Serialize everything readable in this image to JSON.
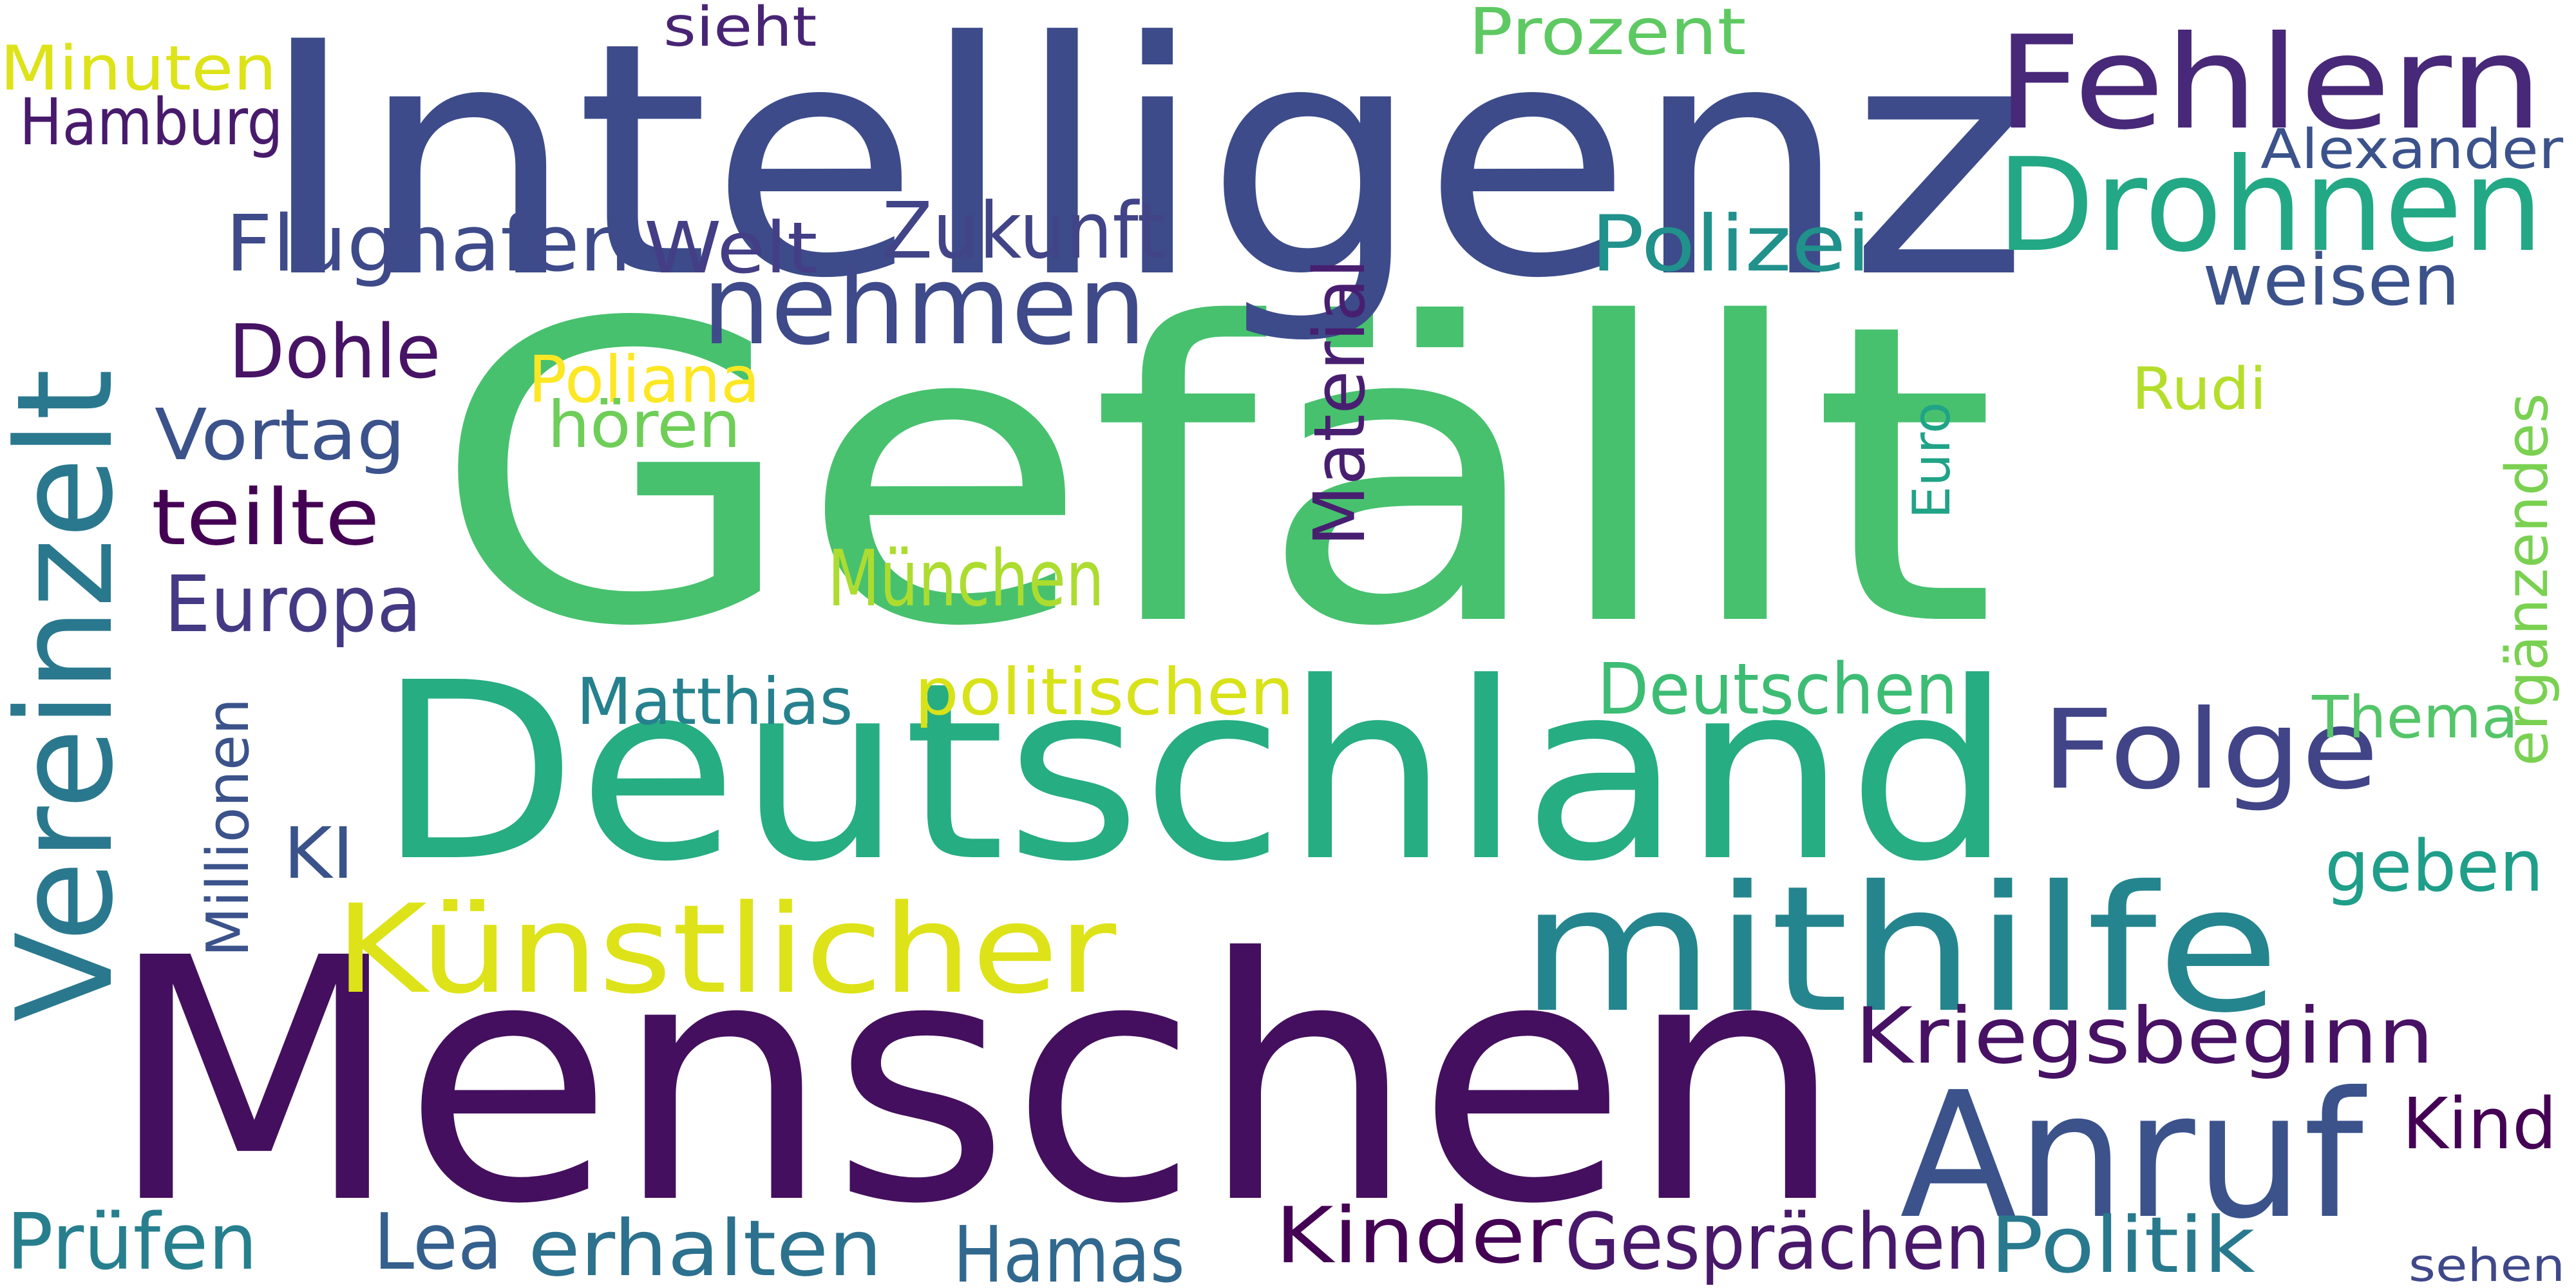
{
  "words": [
    {
      "text": "Gefällt",
      "color": "#47c16e"
    },
    {
      "text": "Menschen",
      "color": "#440f5e"
    },
    {
      "text": "Intelligenz",
      "color": "#3d4b8a"
    },
    {
      "text": "Deutschland",
      "color": "#26ad81"
    },
    {
      "text": "Vereinzelt",
      "color": "#2a788e"
    },
    {
      "text": "mithilfe",
      "color": "#25858e"
    },
    {
      "text": "Künstlicher",
      "color": "#dde318"
    },
    {
      "text": "Anruf",
      "color": "#3b528b"
    },
    {
      "text": "Fehlern",
      "color": "#482878"
    },
    {
      "text": "Drohnen",
      "color": "#22a884"
    },
    {
      "text": "nehmen",
      "color": "#3e4a89"
    },
    {
      "text": "Folge",
      "color": "#414487"
    },
    {
      "text": "Kriegsbeginn",
      "color": "#471164"
    },
    {
      "text": "Prozent",
      "color": "#5ec962"
    },
    {
      "text": "Alexander",
      "color": "#3b528b"
    },
    {
      "text": "Minuten",
      "color": "#dde318"
    },
    {
      "text": "sieht",
      "color": "#482475"
    },
    {
      "text": "Hamburg",
      "color": "#481a6c"
    },
    {
      "text": "Flughafen",
      "color": "#3e4a89"
    },
    {
      "text": "Welt",
      "color": "#433e85"
    },
    {
      "text": "Zukunft",
      "color": "#414487"
    },
    {
      "text": "Polizei",
      "color": "#21918c"
    },
    {
      "text": "weisen",
      "color": "#3b528b"
    },
    {
      "text": "Dohle",
      "color": "#471365"
    },
    {
      "text": "Poliana",
      "color": "#fde725"
    },
    {
      "text": "hören",
      "color": "#6ece58"
    },
    {
      "text": "Rudi",
      "color": "#b5de2b"
    },
    {
      "text": "Vortag",
      "color": "#3b528b"
    },
    {
      "text": "Material",
      "color": "#481f70"
    },
    {
      "text": "Euro",
      "color": "#20a386"
    },
    {
      "text": "ergänzendes",
      "color": "#7ad151"
    },
    {
      "text": "teilte",
      "color": "#440154"
    },
    {
      "text": "München",
      "color": "#addc30"
    },
    {
      "text": "Europa",
      "color": "#443983"
    },
    {
      "text": "Matthias",
      "color": "#26818e"
    },
    {
      "text": "politischen",
      "color": "#d8e219"
    },
    {
      "text": "Deutschen",
      "color": "#3dbc74"
    },
    {
      "text": "Thema",
      "color": "#54c568"
    },
    {
      "text": "Millionen",
      "color": "#3b528b"
    },
    {
      "text": "KI",
      "color": "#3a538b"
    },
    {
      "text": "geben",
      "color": "#1f9e89"
    },
    {
      "text": "Kind",
      "color": "#440154"
    },
    {
      "text": "Prüfen",
      "color": "#277f8e"
    },
    {
      "text": "Lea",
      "color": "#355f8d"
    },
    {
      "text": "erhalten",
      "color": "#2c718e"
    },
    {
      "text": "Hamas",
      "color": "#31688e"
    },
    {
      "text": "Kinder",
      "color": "#440154"
    },
    {
      "text": "Gesprächen",
      "color": "#48186a"
    },
    {
      "text": "Politik",
      "color": "#29798e"
    },
    {
      "text": "sehen",
      "color": "#3f4889"
    }
  ]
}
